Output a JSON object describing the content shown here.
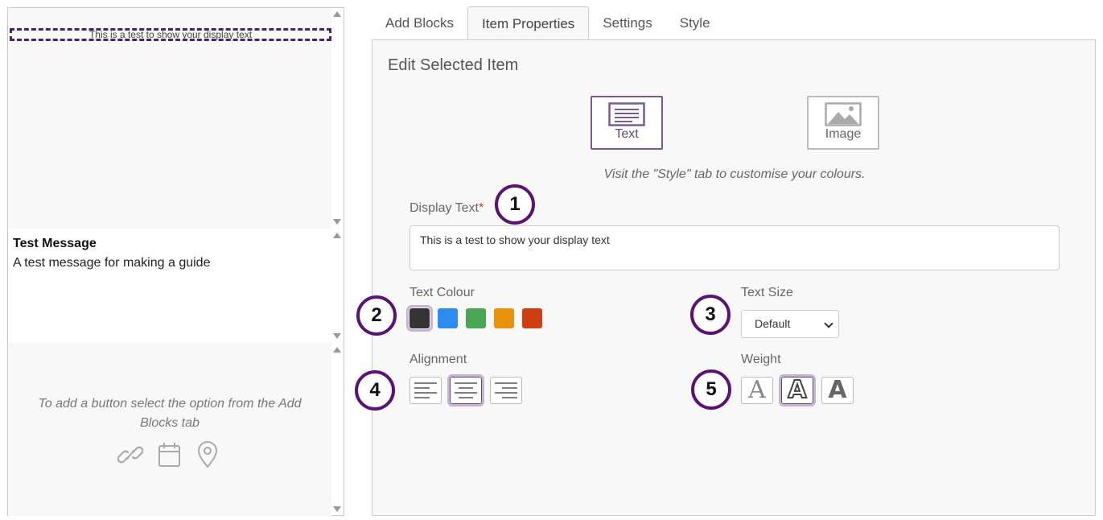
{
  "preview": {
    "display_text": "This is a test to show your display text",
    "message_title": "Test Message",
    "message_body": "A test message for making a guide",
    "button_hint": "To add a button select the option from the Add Blocks tab",
    "hint_icons": [
      "link-icon",
      "calendar-icon",
      "location-pin-icon"
    ]
  },
  "tabs": [
    {
      "label": "Add Blocks",
      "active": false
    },
    {
      "label": "Item Properties",
      "active": true
    },
    {
      "label": "Settings",
      "active": false
    },
    {
      "label": "Style",
      "active": false
    }
  ],
  "editor": {
    "title": "Edit Selected Item",
    "type_text_label": "Text",
    "type_image_label": "Image",
    "selected_type": "Text",
    "style_hint": "Visit the \"Style\" tab to customise your colours.",
    "display_text_label": "Display Text",
    "required_mark": "*",
    "display_text_value": "This is a test to show your display text",
    "text_colour_label": "Text Colour",
    "colours": [
      "#333333",
      "#2d8cf0",
      "#4aa654",
      "#e8930c",
      "#d13d12"
    ],
    "selected_colour": "#333333",
    "text_size_label": "Text Size",
    "text_size_value": "Default",
    "alignment_label": "Alignment",
    "alignment_options": [
      "left",
      "center",
      "right"
    ],
    "selected_alignment": "center",
    "weight_label": "Weight",
    "weight_options": [
      "light",
      "normal",
      "bold"
    ],
    "selected_weight": "normal",
    "accent_color": "#7a5a91"
  },
  "steps": [
    "1",
    "2",
    "3",
    "4",
    "5"
  ]
}
